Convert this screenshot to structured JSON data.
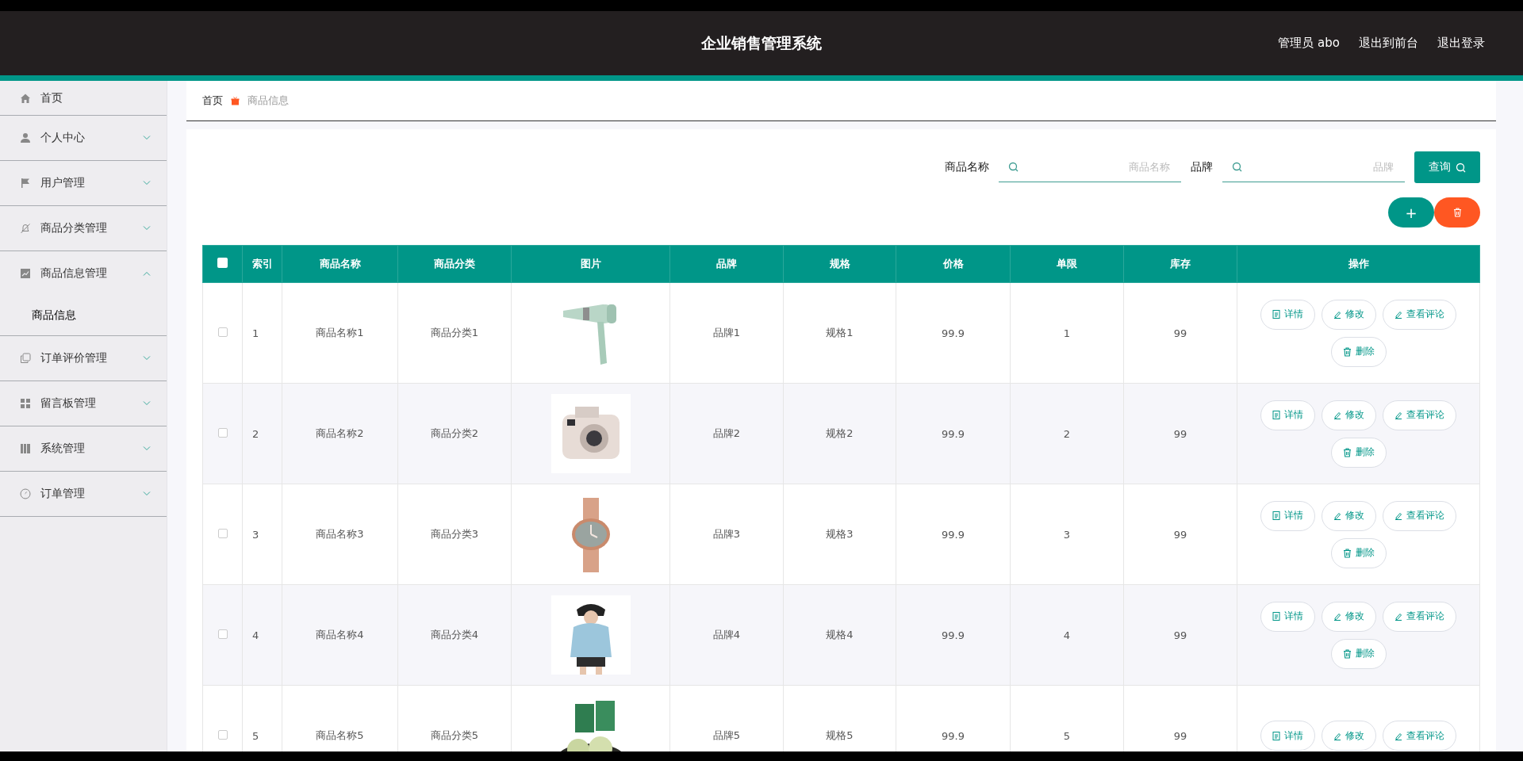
{
  "header": {
    "title": "企业销售管理系统",
    "links": [
      "管理员 abo",
      "退出到前台",
      "退出登录"
    ]
  },
  "sidebar": {
    "items": [
      {
        "label": "首页",
        "kind": "link"
      },
      {
        "label": "个人中心",
        "kind": "menu",
        "expanded": false
      },
      {
        "label": "用户管理",
        "kind": "menu",
        "expanded": false
      },
      {
        "label": "商品分类管理",
        "kind": "menu",
        "expanded": false
      },
      {
        "label": "商品信息管理",
        "kind": "menu",
        "expanded": true,
        "children": [
          {
            "label": "商品信息",
            "selected": true
          }
        ]
      },
      {
        "label": "订单评价管理",
        "kind": "menu",
        "expanded": false
      },
      {
        "label": "留言板管理",
        "kind": "menu",
        "expanded": false
      },
      {
        "label": "系统管理",
        "kind": "menu",
        "expanded": false
      },
      {
        "label": "订单管理",
        "kind": "menu",
        "expanded": false
      }
    ]
  },
  "breadcrumb": [
    "首页",
    "商品信息"
  ],
  "search": {
    "fields": [
      {
        "label": "商品名称",
        "placeholder": "商品名称"
      },
      {
        "label": "品牌",
        "placeholder": "品牌"
      }
    ],
    "button": "查询"
  },
  "toolbar": {
    "add": "+"
  },
  "table": {
    "header_checked": false,
    "columns": [
      "索引",
      "商品名称",
      "商品分类",
      "图片",
      "品牌",
      "规格",
      "价格",
      "单限",
      "库存",
      "操作"
    ],
    "rows": [
      {
        "checked": false,
        "cells": [
          "1",
          "商品名称1",
          "商品分类1",
          {
            "kind": "picture"
          },
          "品牌1",
          "规格1",
          "99.9",
          "1",
          "99"
        ],
        "actions": [
          "详情",
          "修改",
          "查看评论",
          "删除"
        ]
      },
      {
        "checked": false,
        "cells": [
          "2",
          "商品名称2",
          "商品分类2",
          {
            "kind": "picture"
          },
          "品牌2",
          "规格2",
          "99.9",
          "2",
          "99"
        ],
        "actions": [
          "详情",
          "修改",
          "查看评论",
          "删除"
        ]
      },
      {
        "checked": false,
        "cells": [
          "3",
          "商品名称3",
          "商品分类3",
          {
            "kind": "picture"
          },
          "品牌3",
          "规格3",
          "99.9",
          "3",
          "99"
        ],
        "actions": [
          "详情",
          "修改",
          "查看评论",
          "删除"
        ]
      },
      {
        "checked": false,
        "cells": [
          "4",
          "商品名称4",
          "商品分类4",
          {
            "kind": "picture"
          },
          "品牌4",
          "规格4",
          "99.9",
          "4",
          "99"
        ],
        "actions": [
          "详情",
          "修改",
          "查看评论",
          "删除"
        ]
      },
      {
        "checked": false,
        "cells": [
          "5",
          "商品名称5",
          "商品分类5",
          {
            "kind": "picture"
          },
          "品牌5",
          "规格5",
          "99.9",
          "5",
          "99"
        ],
        "actions": [
          "详情",
          "修改",
          "查看评论"
        ]
      }
    ]
  }
}
